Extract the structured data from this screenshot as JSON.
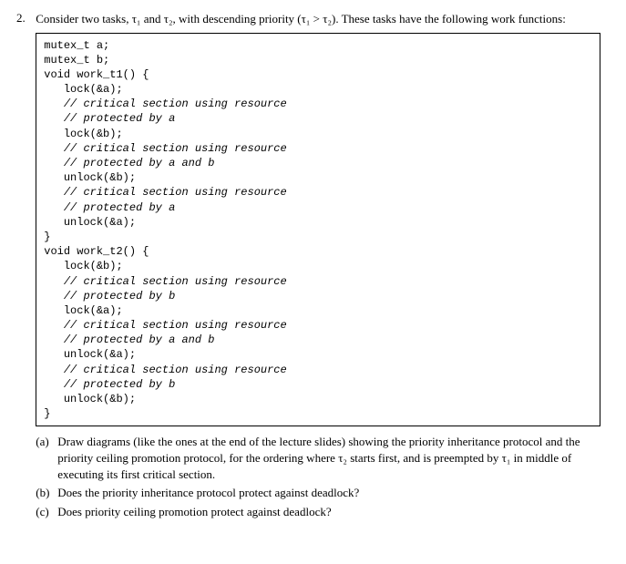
{
  "problem": {
    "number": "2.",
    "intro": "Consider two tasks, τ₁ and τ₂, with descending priority (τ₁ > τ₂). These tasks have the following work functions:"
  },
  "code": {
    "l01": "mutex_t a;",
    "l02": "mutex_t b;",
    "l03": "",
    "l04": "void work_t1() {",
    "l05": "   lock(&a);",
    "l06": "   // critical section using resource",
    "l07": "   // protected by a",
    "l08": "   lock(&b);",
    "l09": "   // critical section using resource",
    "l10": "   // protected by a and b",
    "l11": "   unlock(&b);",
    "l12": "   // critical section using resource",
    "l13": "   // protected by a",
    "l14": "   unlock(&a);",
    "l15": "}",
    "l16": "",
    "l17": "void work_t2() {",
    "l18": "   lock(&b);",
    "l19": "   // critical section using resource",
    "l20": "   // protected by b",
    "l21": "   lock(&a);",
    "l22": "   // critical section using resource",
    "l23": "   // protected by a and b",
    "l24": "   unlock(&a);",
    "l25": "   // critical section using resource",
    "l26": "   // protected by b",
    "l27": "   unlock(&b);",
    "l28": "}"
  },
  "subs": {
    "a": {
      "label": "(a)",
      "text": "Draw diagrams (like the ones at the end of the lecture slides) showing the priority inheritance protocol and the priority ceiling promotion protocol, for the ordering where τ₂ starts first, and is preempted by τ₁ in middle of executing its first critical section."
    },
    "b": {
      "label": "(b)",
      "text": "Does the priority inheritance protocol protect against deadlock?"
    },
    "c": {
      "label": "(c)",
      "text": "Does priority ceiling promotion protect against deadlock?"
    }
  }
}
